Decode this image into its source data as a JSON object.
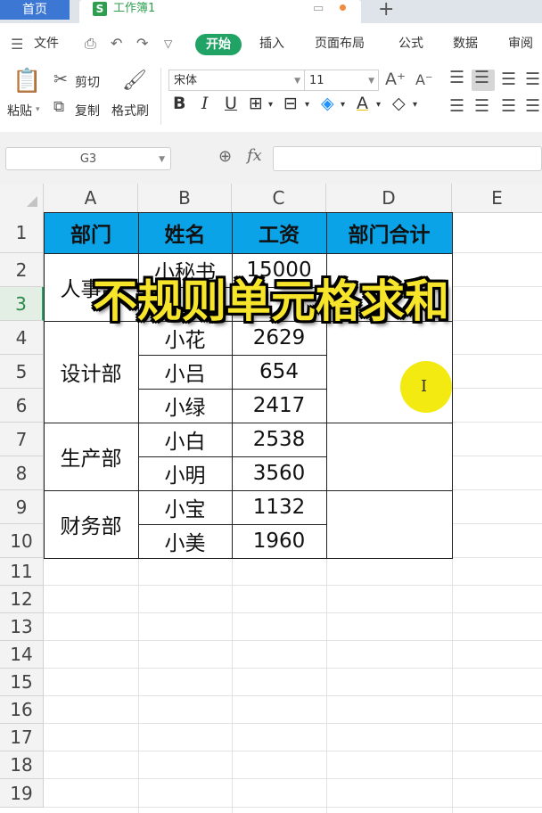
{
  "tabs": {
    "home": "首页",
    "workbook": "工作簿1",
    "workbook_icon": "S",
    "add": "+"
  },
  "menu": {
    "file": "文件",
    "items": [
      "开始",
      "插入",
      "页面布局",
      "公式",
      "数据",
      "审阅"
    ]
  },
  "ribbon": {
    "paste": "粘贴",
    "cut": "剪切",
    "copy": "复制",
    "format_painter": "格式刷",
    "font_name": "宋体",
    "font_size": "11",
    "bold": "B",
    "italic": "I",
    "underline": "U"
  },
  "formula_bar": {
    "name_box": "G3",
    "fx": "fx",
    "formula": ""
  },
  "sheet": {
    "columns": [
      "A",
      "B",
      "C",
      "D",
      "E"
    ],
    "rows": [
      "1",
      "2",
      "3",
      "4",
      "5",
      "6",
      "7",
      "8",
      "9",
      "10",
      "11",
      "12",
      "13",
      "14",
      "15",
      "16",
      "17",
      "18",
      "19"
    ],
    "selected_row": "3",
    "header": [
      "部门",
      "姓名",
      "工资",
      "部门合计"
    ],
    "departments": [
      "人事部",
      "设计部",
      "生产部",
      "财务部"
    ],
    "names": [
      "小秘书",
      "小花",
      "小吕",
      "小绿",
      "小白",
      "小明",
      "小宝",
      "小美"
    ],
    "salaries": [
      "15000",
      "2629",
      "654",
      "2417",
      "2538",
      "3560",
      "1132",
      "1960"
    ]
  },
  "overlay_title": "不规则单元格求和",
  "colors": {
    "header_fill": "#0aa3e8",
    "accent": "#21a366",
    "overlay_text": "#f6e52a",
    "cursor_highlight": "#f3ea12"
  }
}
